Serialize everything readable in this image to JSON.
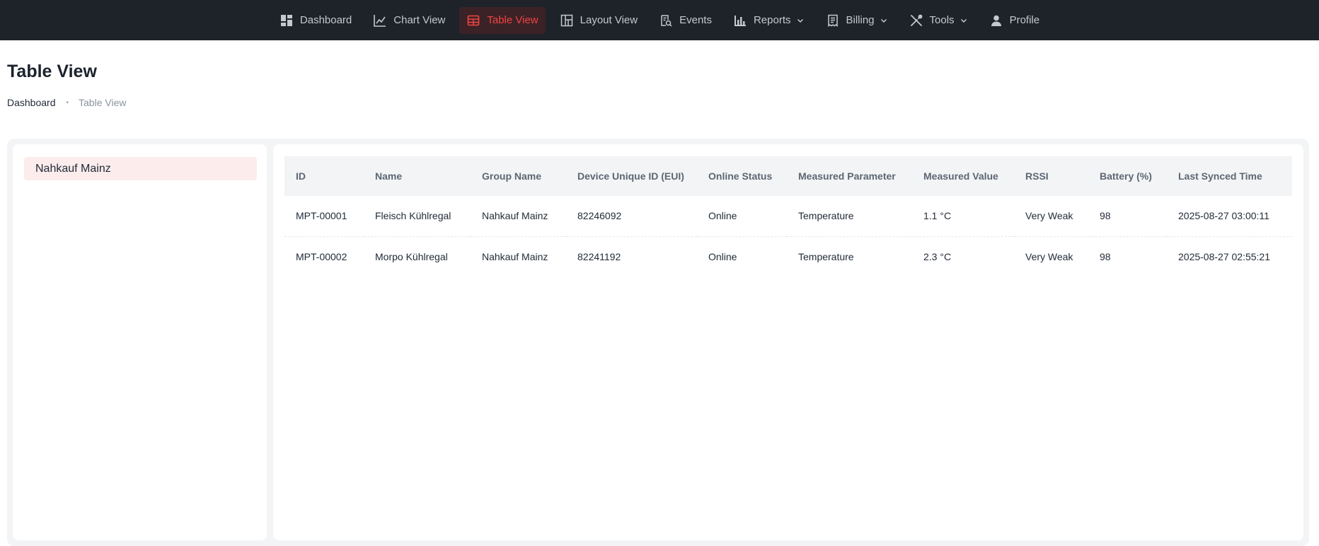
{
  "nav": {
    "items": [
      {
        "label": "Dashboard",
        "icon": "dashboard-icon",
        "active": false,
        "dropdown": false
      },
      {
        "label": "Chart View",
        "icon": "line-chart-icon",
        "active": false,
        "dropdown": false
      },
      {
        "label": "Table View",
        "icon": "table-icon",
        "active": true,
        "dropdown": false
      },
      {
        "label": "Layout View",
        "icon": "layout-icon",
        "active": false,
        "dropdown": false
      },
      {
        "label": "Events",
        "icon": "events-icon",
        "active": false,
        "dropdown": false
      },
      {
        "label": "Reports",
        "icon": "bar-chart-icon",
        "active": false,
        "dropdown": true
      },
      {
        "label": "Billing",
        "icon": "receipt-icon",
        "active": false,
        "dropdown": true
      },
      {
        "label": "Tools",
        "icon": "tools-icon",
        "active": false,
        "dropdown": true
      },
      {
        "label": "Profile",
        "icon": "user-icon",
        "active": false,
        "dropdown": false
      }
    ],
    "colors": {
      "background": "#1e232a",
      "active": "#ef4444",
      "text": "#c3c9d1"
    }
  },
  "page": {
    "title": "Table View",
    "breadcrumb": {
      "home": "Dashboard",
      "separator": "•",
      "current": "Table View"
    }
  },
  "sidebar": {
    "groups": [
      {
        "label": "Nahkauf Mainz",
        "selected": true
      }
    ]
  },
  "table": {
    "columns": [
      "ID",
      "Name",
      "Group Name",
      "Device Unique ID (EUI)",
      "Online Status",
      "Measured Parameter",
      "Measured Value",
      "RSSI",
      "Battery (%)",
      "Last Synced Time"
    ],
    "rows": [
      {
        "id": "MPT-00001",
        "name": "Fleisch Kühlregal",
        "group": "Nahkauf Mainz",
        "eui": "82246092",
        "status": "Online",
        "parameter": "Temperature",
        "value": "1.1 °C",
        "rssi": "Very Weak",
        "battery": "98",
        "synced": "2025-08-27 03:00:11"
      },
      {
        "id": "MPT-00002",
        "name": "Morpo Kühlregal",
        "group": "Nahkauf Mainz",
        "eui": "82241192",
        "status": "Online",
        "parameter": "Temperature",
        "value": "2.3 °C",
        "rssi": "Very Weak",
        "battery": "98",
        "synced": "2025-08-27 02:55:21"
      }
    ],
    "status_color": "#22b04b"
  }
}
